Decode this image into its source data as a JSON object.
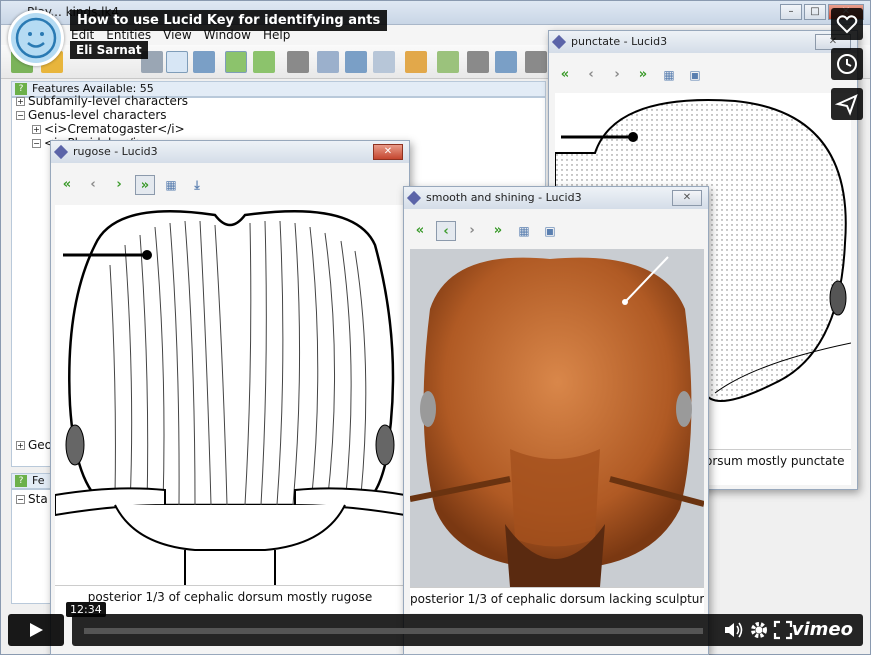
{
  "main_window": {
    "title": "Play... kinds.lk4",
    "menu": [
      "Edit",
      "Entities",
      "View",
      "Window",
      "Help"
    ],
    "features_available": "Features Available: 55",
    "features_tab": "Fe",
    "tree": {
      "subfamily": "Subfamily-level characters",
      "genus": "Genus-level characters",
      "crematogaster": "<i>Crematogaster</i>",
      "pheidole": "<i>Pheidole</i>",
      "geo": "Geo",
      "sta": "Sta"
    }
  },
  "window_rugose": {
    "title": "rugose - Lucid3",
    "caption": "posterior 1/3 of cephalic dorsum mostly rugose"
  },
  "window_smooth": {
    "title": "smooth and shining - Lucid3",
    "caption": "posterior 1/3 of cephalic dorsum lacking sculpture"
  },
  "window_punctate": {
    "title": "punctate - Lucid3",
    "caption": "orsum mostly punctate"
  },
  "video": {
    "title": "How to use Lucid Key for identifying ants",
    "author": "Eli Sarnat",
    "time": "12:34",
    "progress": 0.0,
    "brand": "vimeo"
  },
  "icons": {
    "like": "heart-icon",
    "watch_later": "clock-icon",
    "share": "paper-plane-icon",
    "volume": "volume-icon",
    "settings": "gear-icon",
    "fullscreen": "fullscreen-icon"
  }
}
